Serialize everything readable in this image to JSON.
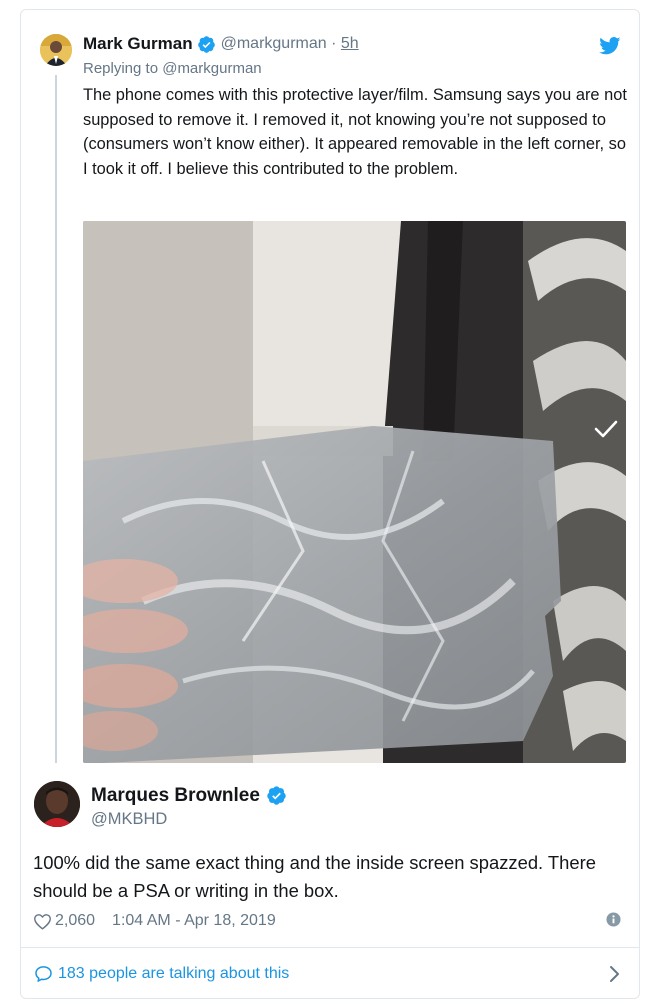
{
  "parent_tweet": {
    "name": "Mark Gurman",
    "handle": "@markgurman",
    "separator": "·",
    "time": "5h",
    "replying_to": "Replying to @markgurman",
    "text": "The phone comes with this protective layer/film. Samsung says you are not supposed to remove it. I removed it, not knowing you’re not supposed to (consumers won’t know either). It appeared removable in the left corner, so I took it off. I believe this contributed to the problem.",
    "verified_icon": "verified-badge-icon",
    "photo_icon": "checkmark-icon"
  },
  "main_tweet": {
    "name": "Marques Brownlee",
    "handle": "@MKBHD",
    "text": "100% did the same exact thing and the inside screen spazzed. There should be a PSA or writing in the box.",
    "likes": "2,060",
    "timestamp": "1:04 AM - Apr 18, 2019"
  },
  "footer": {
    "talking_label": "183 people are talking about this"
  },
  "colors": {
    "twitter_blue": "#1da1f2",
    "link_blue": "#1b95e0",
    "secondary_text": "#657786",
    "primary_text": "#14171a",
    "border": "#e1e8ed"
  }
}
